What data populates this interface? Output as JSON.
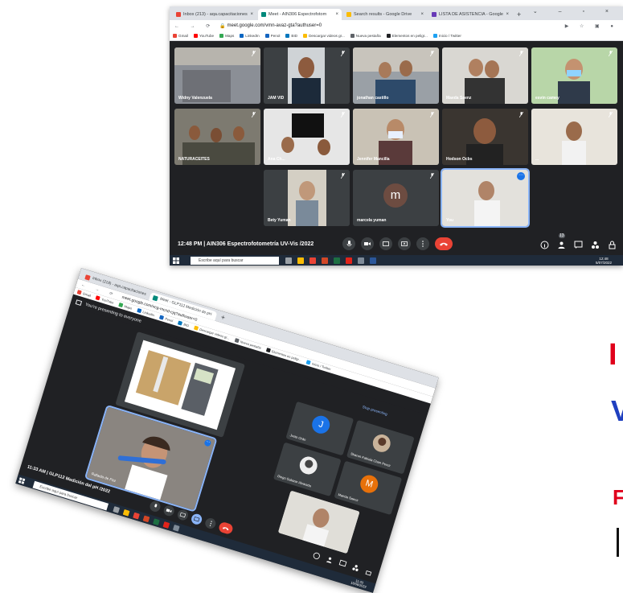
{
  "shot1": {
    "tabs": [
      {
        "label": "Inbox (213) - aqa.capacitaciones",
        "color": "#ea4335"
      },
      {
        "label": "Meet - AIN306 Espectrofotom",
        "color": "#00897b"
      },
      {
        "label": "Search results - Google Drive",
        "color": "#fbbc04"
      },
      {
        "label": "LISTA DE ASISTENCIA - Google",
        "color": "#673ab7"
      }
    ],
    "url": "meet.google.com/vmn-avaz-gta?authuser=0",
    "bookmarks": [
      "Gmail",
      "YouTube",
      "Maps",
      "LinkedIn",
      "Penol",
      "BID",
      "Descargar videos gr...",
      "Nueva pestaña",
      "Elementos en peligr...",
      "Inicio / Twitter"
    ],
    "participants": [
      "Widny Valenzuela",
      "JAM VID",
      "jonathan castillo",
      "Maeda Saenz",
      "esvin camey",
      "NATURACEITES",
      "Ana Ch...",
      "Jennifer Mancilla",
      "Hodson Ocbs",
      "...",
      "Bety Yuman",
      "marcela yuman",
      "You"
    ],
    "avatar_letter": "m",
    "meeting_info": "12:48 PM  |  AIN306 Espectrofotometría UV-Vis /2022",
    "participant_count": "13",
    "taskbar_search": "Escribe aquí para buscar",
    "clock_time": "12:48",
    "clock_date": "5/07/2022"
  },
  "shot2": {
    "tabs": [
      {
        "label": "Inbox (218) - aqa.capacitaciones",
        "color": "#ea4335"
      },
      {
        "label": "Meet - GLP112 Medición de pH",
        "color": "#00897b"
      }
    ],
    "url": "meet.google.com/ncg-mcnd-cjq?authuser=0",
    "bookmarks": [
      "Gmail",
      "YouTube",
      "Maps",
      "LinkedIn",
      "Penol",
      "BID",
      "Descargar videos gr...",
      "Nueva pestaña",
      "Elementos en peligr...",
      "Inicio / Twitter"
    ],
    "presenting_banner": "You're presenting to everyone",
    "stop_presenting": "Stop presenting",
    "self_name": "Rafaela de Paz",
    "participants": [
      {
        "name": "Justo Orán",
        "letter": "J",
        "color": "#1a73e8"
      },
      {
        "name": "Sharon Fabiola Chan Perez",
        "letter": "",
        "color": "#5f6368"
      },
      {
        "name": "Diego Salazar Alvarado",
        "letter": "",
        "color": "#5f6368"
      },
      {
        "name": "Maeda Saenz",
        "letter": "M",
        "color": "#e8710a"
      }
    ],
    "meeting_info": "11:33 AM  |  GLP112 Medición del pH /2022",
    "taskbar_search": "Escribe aquí para buscar",
    "clock_time": "11:33",
    "clock_date": "16/06/2022"
  },
  "slide_fragments": {
    "red1": "I",
    "blue": "V",
    "red2": "F"
  }
}
